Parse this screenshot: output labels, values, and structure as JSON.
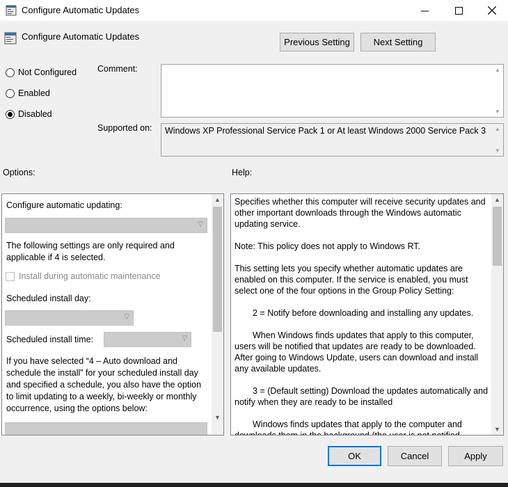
{
  "window": {
    "title": "Configure Automatic Updates"
  },
  "header": {
    "policy_title": "Configure Automatic Updates",
    "prev_label": "Previous Setting",
    "next_label": "Next Setting"
  },
  "state": {
    "options": [
      {
        "label": "Not Configured",
        "checked": false
      },
      {
        "label": "Enabled",
        "checked": false
      },
      {
        "label": "Disabled",
        "checked": true
      }
    ]
  },
  "comment": {
    "label": "Comment:",
    "value": ""
  },
  "supported": {
    "label": "Supported on:",
    "value": "Windows XP Professional Service Pack 1 or At least Windows 2000 Service Pack 3"
  },
  "options_pane": {
    "label": "Options:",
    "configure_label": "Configure automatic updating:",
    "note": "The following settings are only required and applicable if 4 is selected.",
    "maintenance_label": "Install during automatic maintenance",
    "install_day_label": "Scheduled install day:",
    "install_time_label": "Scheduled install time:",
    "schedule_note": "If you have selected “4 – Auto download and schedule the install” for your scheduled install day and specified a schedule, you also have the option to limit updating to a weekly, bi-weekly or monthly occurrence, using the options below:"
  },
  "help_pane": {
    "label": "Help:",
    "paragraphs": [
      "Specifies whether this computer will receive security updates and other important downloads through the Windows automatic updating service.",
      "Note: This policy does not apply to Windows RT.",
      "This setting lets you specify whether automatic updates are enabled on this computer. If the service is enabled, you must select one of the four options in the Group Policy Setting:",
      "2 = Notify before downloading and installing any updates.",
      "When Windows finds updates that apply to this computer, users will be notified that updates are ready to be downloaded. After going to Windows Update, users can download and install any available updates.",
      "3 = (Default setting) Download the updates automatically and notify when they are ready to be installed",
      "Windows finds updates that apply to the computer and downloads them in the background (the user is not notified"
    ]
  },
  "footer": {
    "ok_label": "OK",
    "cancel_label": "Cancel",
    "apply_label": "Apply"
  }
}
